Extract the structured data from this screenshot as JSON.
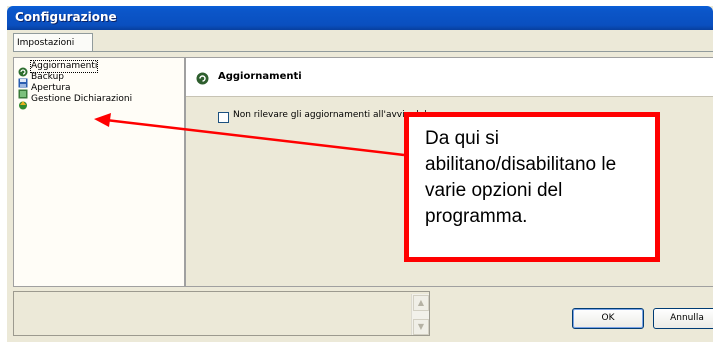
{
  "window": {
    "title": "Configurazione",
    "tab_label": "Impostazioni"
  },
  "tree": {
    "items": [
      {
        "label": "Aggiornamenti",
        "icon": "refresh-icon",
        "selected": true
      },
      {
        "label": "Backup",
        "icon": "backup-icon",
        "selected": false
      },
      {
        "label": "Apertura",
        "icon": "open-icon",
        "selected": false
      },
      {
        "label": "Gestione Dichiarazioni",
        "icon": "declarations-icon",
        "selected": false
      }
    ]
  },
  "panel": {
    "title": "Aggiornamenti",
    "checkbox_label": "Non rilevare gli aggiornamenti all'avvio del programma",
    "checkbox_checked": false
  },
  "buttons": {
    "ok": "OK",
    "cancel": "Annulla"
  },
  "callout": {
    "text": "Da qui si abilitano/disabilitano le varie opzioni del programma."
  },
  "colors": {
    "titlebar": "#0a4fbf",
    "window_bg": "#ece9d8",
    "callout_border": "#ff0000",
    "arrow": "#ff0000"
  }
}
